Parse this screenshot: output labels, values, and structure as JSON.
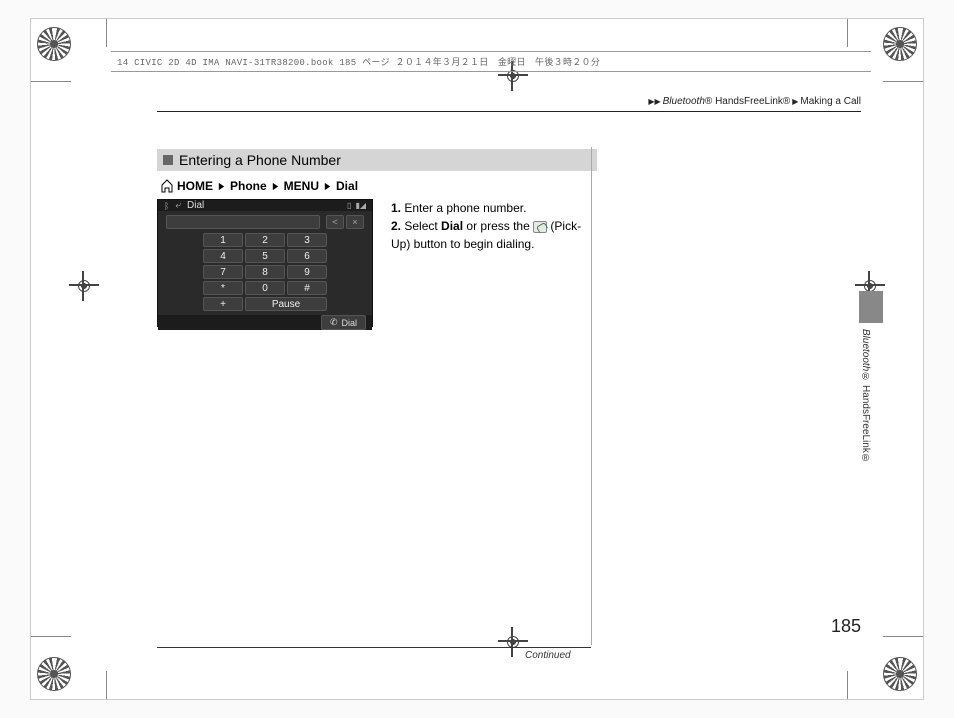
{
  "header_meta": "14 CIVIC 2D 4D IMA NAVI-31TR38200.book  185 ページ  ２０１４年３月２１日　金曜日　午後３時２０分",
  "breadcrumb": {
    "a": "Bluetooth",
    "a_suffix": "®",
    "b": "HandsFreeLink®",
    "c": "Making a Call"
  },
  "section_title": "Entering a Phone Number",
  "nav_path": [
    "HOME",
    "Phone",
    "MENU",
    "Dial"
  ],
  "device": {
    "title": "Dial",
    "status_right": "",
    "entry_back": "<",
    "entry_clear": "×",
    "keys": [
      [
        "1",
        "2",
        "3"
      ],
      [
        "4",
        "5",
        "6"
      ],
      [
        "7",
        "8",
        "9"
      ],
      [
        "*",
        "0",
        "#"
      ]
    ],
    "bottom_left": "+",
    "bottom_wide": "Pause",
    "footer_button": "Dial"
  },
  "steps": {
    "s1_num": "1.",
    "s1": "Enter a phone number.",
    "s2_num": "2.",
    "s2a": "Select ",
    "s2_bold": "Dial",
    "s2b": " or press the ",
    "s2c": " (Pick-Up) button to begin dialing."
  },
  "continued": "Continued",
  "page_number": "185",
  "side_label_a": "Bluetooth",
  "side_label_a_suffix": "®",
  "side_label_b": " HandsFreeLink®"
}
